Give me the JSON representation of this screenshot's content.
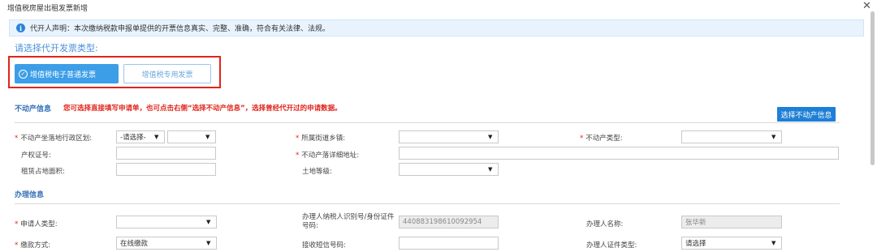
{
  "dialog": {
    "title": "增值税房屋出租发票新增",
    "close_icon": "close-icon"
  },
  "notice": {
    "icon": "info-icon",
    "text": "代开人声明：本次缴纳税款申报单提供的开票信息真实、完整、准确，符合有关法律、法规。"
  },
  "invoice_type": {
    "prompt": "请选择代开发票类型:",
    "electronic_label": "增值税电子普通发票",
    "special_label": "增值税专用发票",
    "selected": "增值税电子普通发票"
  },
  "property_section": {
    "title": "不动产信息",
    "hint": "您可选择直接填写申请单，也可点击右侧“选择不动产信息”，选择曾经代开过的申请数据。",
    "select_button": "选择不动产信息",
    "fields": {
      "region_label": "不动产坐落地行政区划:",
      "region_value": "-请选择-",
      "region_sub_value": "",
      "street_label": "所属街道乡镇:",
      "street_value": "",
      "type_label": "不动产类型:",
      "type_value": "",
      "cert_label": "产权证号:",
      "cert_value": "",
      "address_label": "不动产落详细地址:",
      "address_value": "",
      "area_label": "租赁占地面积:",
      "area_value": "",
      "land_label": "土地等级:",
      "land_value": ""
    }
  },
  "handling_section": {
    "title": "办理信息",
    "fields": {
      "applicant_type_label": "申请人类型:",
      "applicant_type_value": "",
      "taxpayer_id_label": "办理人纳税人识别号/身份证件号码:",
      "taxpayer_id_value": "440883198610092954",
      "handler_name_label": "办理人名称:",
      "handler_name_value": "张华新",
      "payment_label": "缴款方式:",
      "payment_value": "在线缴款",
      "sms_label": "接收短信号码:",
      "sms_value": "",
      "handler_id_type_label": "办理人证件类型:",
      "handler_id_type_value": "请选择"
    }
  },
  "colors": {
    "accent": "#3d9ee8",
    "required": "#e0251b",
    "highlight_box": "#e0251b",
    "section_title": "#3572b8"
  }
}
